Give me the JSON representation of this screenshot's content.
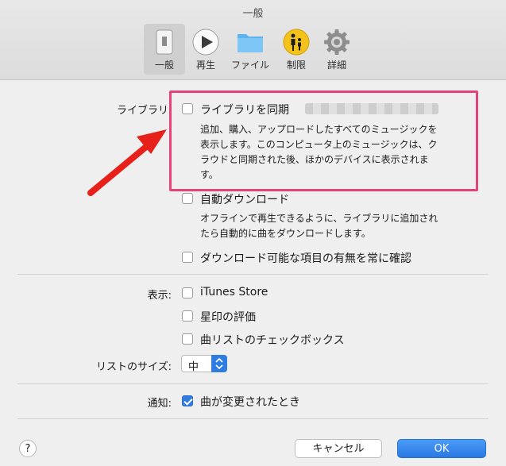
{
  "window": {
    "title": "一般"
  },
  "toolbar": {
    "tabs": [
      {
        "label": "一般",
        "icon": "switch-icon"
      },
      {
        "label": "再生",
        "icon": "play-icon"
      },
      {
        "label": "ファイル",
        "icon": "folder-icon"
      },
      {
        "label": "制限",
        "icon": "parental-icon"
      },
      {
        "label": "詳細",
        "icon": "gear-icon"
      }
    ]
  },
  "library": {
    "label": "ライブラリ",
    "sync_label": "ライブラリを同期",
    "sync_desc": [
      "追加、購入、アップロードしたすべてのミュージックを",
      "表示します。このコンピュータ上のミュージックは、ク",
      "ラウドと同期された後、ほかのデバイスに表示されま",
      "す。"
    ],
    "auto_download_label": "自動ダウンロード",
    "auto_download_desc": [
      "オフラインで再生できるように、ライブラリに追加され",
      "たら自動的に曲をダウンロードします。"
    ],
    "always_check_label": "ダウンロード可能な項目の有無を常に確認"
  },
  "display": {
    "label": "表示:",
    "itunes_store": "iTunes Store",
    "star_ratings": "星印の評価",
    "song_checkboxes": "曲リストのチェックボックス"
  },
  "list_size": {
    "label": "リストのサイズ:",
    "value": "中"
  },
  "notifications": {
    "label": "通知:",
    "song_changes": "曲が変更されたとき"
  },
  "buttons": {
    "help": "?",
    "cancel": "キャンセル",
    "ok": "OK"
  },
  "colors": {
    "accent": "#2f7de1",
    "highlight": "#e8427a",
    "arrow": "#e8201a"
  }
}
